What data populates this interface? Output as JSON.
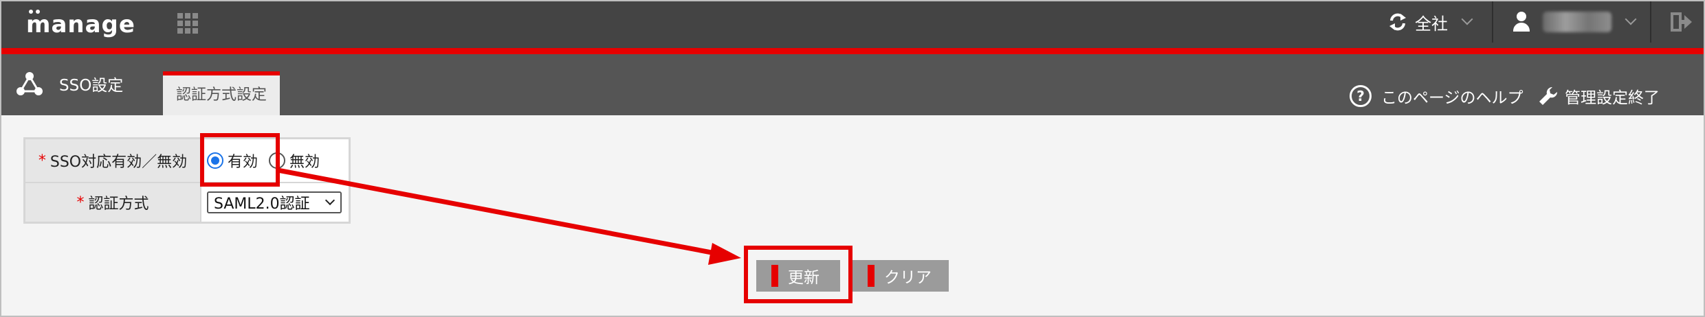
{
  "header": {
    "logo_text": "manage",
    "company_selector": "全社",
    "colors": {
      "topbar": "#444444",
      "accent": "#e60000",
      "subbar": "#555555"
    }
  },
  "subheader": {
    "section_title": "SSO設定",
    "active_tab": "認証方式設定",
    "help_link": "このページのヘルプ",
    "admin_exit": "管理設定終了"
  },
  "form": {
    "rows": [
      {
        "label": "SSO対応有効／無効",
        "required_mark": "*",
        "options": [
          "有効",
          "無効"
        ],
        "selected": "有効"
      },
      {
        "label": "認証方式",
        "required_mark": "*",
        "select_value": "SAML2.0認証"
      }
    ]
  },
  "buttons": {
    "update": "更新",
    "clear": "クリア"
  },
  "icons": {
    "apps": "grid-icon",
    "sync": "sync-icon",
    "user": "user-icon",
    "logout": "logout-icon",
    "sso": "share-network-icon",
    "help": "question-circle-icon",
    "wrench": "wrench-icon"
  }
}
